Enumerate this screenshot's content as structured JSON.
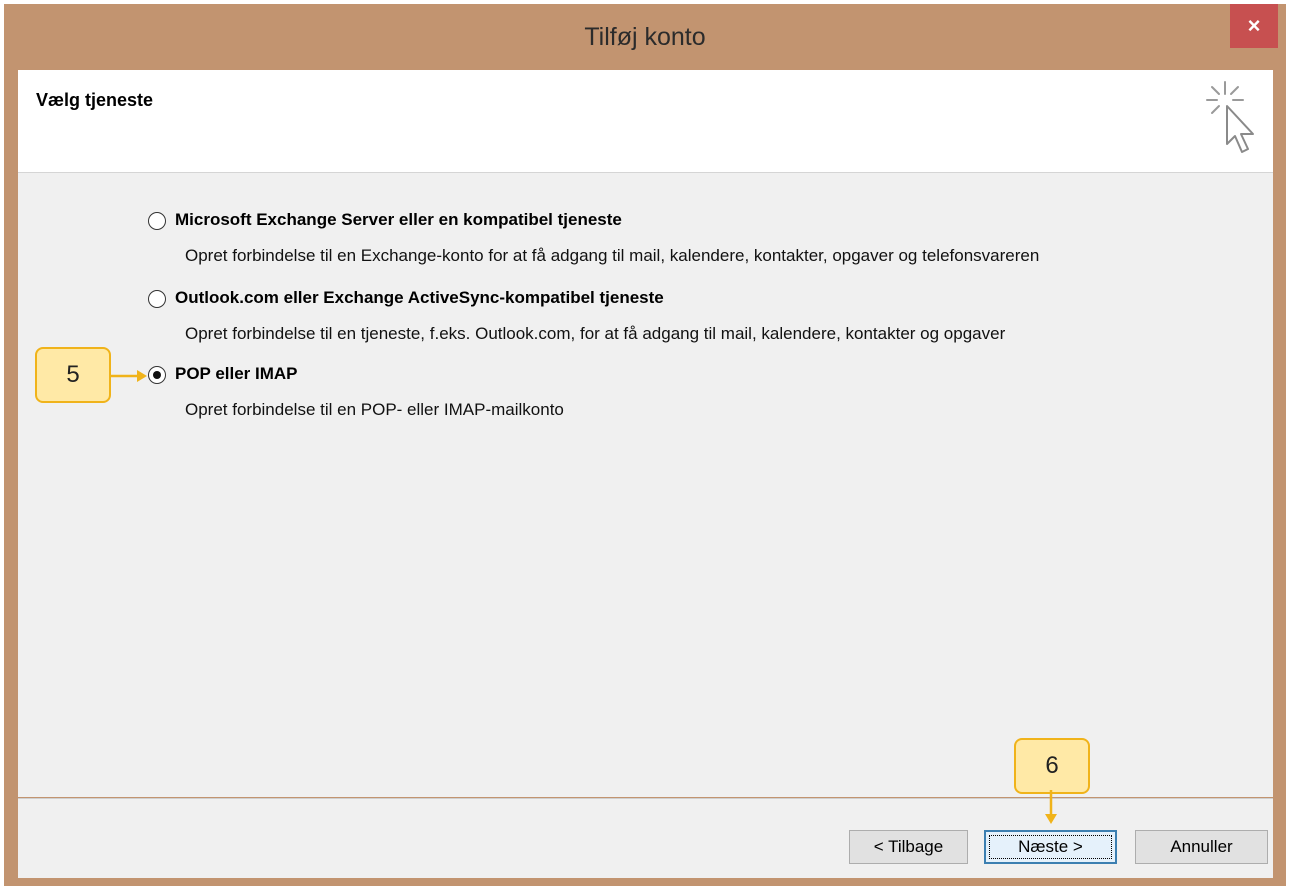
{
  "window": {
    "title": "Tilføj konto",
    "close_glyph": "×"
  },
  "header": {
    "title": "Vælg tjeneste",
    "icon": "cursor-click-icon"
  },
  "options": [
    {
      "label": "Microsoft Exchange Server eller en kompatibel tjeneste",
      "description": "Opret forbindelse til en Exchange-konto for at få adgang til mail, kalendere, kontakter, opgaver og telefonsvareren",
      "selected": false
    },
    {
      "label": "Outlook.com eller Exchange ActiveSync-kompatibel tjeneste",
      "description": "Opret forbindelse til en tjeneste, f.eks. Outlook.com, for at få adgang til mail, kalendere, kontakter og opgaver",
      "selected": false
    },
    {
      "label": "POP eller IMAP",
      "description": "Opret forbindelse til en POP- eller IMAP-mailkonto",
      "selected": true
    }
  ],
  "buttons": {
    "back": "< Tilbage",
    "next": "Næste >",
    "cancel": "Annuller"
  },
  "callouts": {
    "step5": "5",
    "step6": "6"
  },
  "colors": {
    "titlebar": "#c29470",
    "close": "#c75050",
    "callout_fill": "#ffe9a6",
    "callout_border": "#f0b31a"
  }
}
